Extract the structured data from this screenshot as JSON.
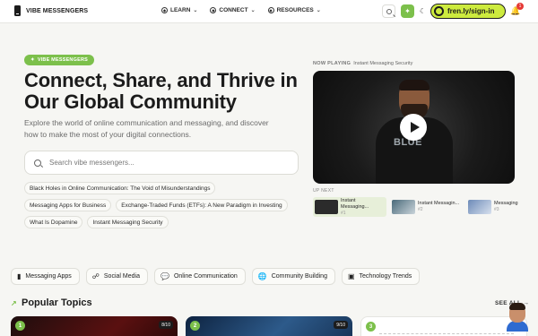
{
  "header": {
    "brand": "VIBE MESSENGERS",
    "nav": [
      {
        "label": "LEARN"
      },
      {
        "label": "CONNECT"
      },
      {
        "label": "RESOURCES"
      }
    ],
    "signin_label": "fren.ly/sign-in",
    "notification_count": "1"
  },
  "hero": {
    "pill": "VIBE MESSENGERS",
    "title": "Connect, Share, and Thrive in Our Global Community",
    "subtitle": "Explore the world of online communication and messaging, and discover how to make the most of your digital connections.",
    "search_placeholder": "Search vibe messengers...",
    "tags": [
      "Black Holes in Online Communication: The Void of Misunderstandings",
      "Messaging Apps for Business",
      "Exchange-Traded Funds (ETFs): A New Paradigm in Investing",
      "What Is Dopamine",
      "Instant Messaging Security"
    ]
  },
  "player": {
    "now_playing_label": "NOW PLAYING",
    "now_playing_title": "Instant Messaging Security",
    "shirt_text": "BLUE",
    "up_next_label": "UP NEXT",
    "queue": [
      {
        "title": "Instant Messaging...",
        "num": "#1"
      },
      {
        "title": "Instant Messagin...",
        "num": "#2"
      },
      {
        "title": "Messaging",
        "num": "#3"
      }
    ]
  },
  "categories": [
    {
      "label": "Messaging Apps",
      "icon": "phone-icon"
    },
    {
      "label": "Social Media",
      "icon": "social-icon"
    },
    {
      "label": "Online Communication",
      "icon": "chat-bubble-icon"
    },
    {
      "label": "Community Building",
      "icon": "globe-icon"
    },
    {
      "label": "Technology Trends",
      "icon": "computer-icon"
    }
  ],
  "popular": {
    "title": "Popular Topics",
    "see_all": "SEE ALL",
    "cards": [
      {
        "num": "1",
        "score": "8/10"
      },
      {
        "num": "2",
        "score": "9/10"
      },
      {
        "num": "3"
      }
    ]
  },
  "colors": {
    "accent": "#7cc04b",
    "signin_bg": "#cdeb3e",
    "badge": "#e53935"
  }
}
